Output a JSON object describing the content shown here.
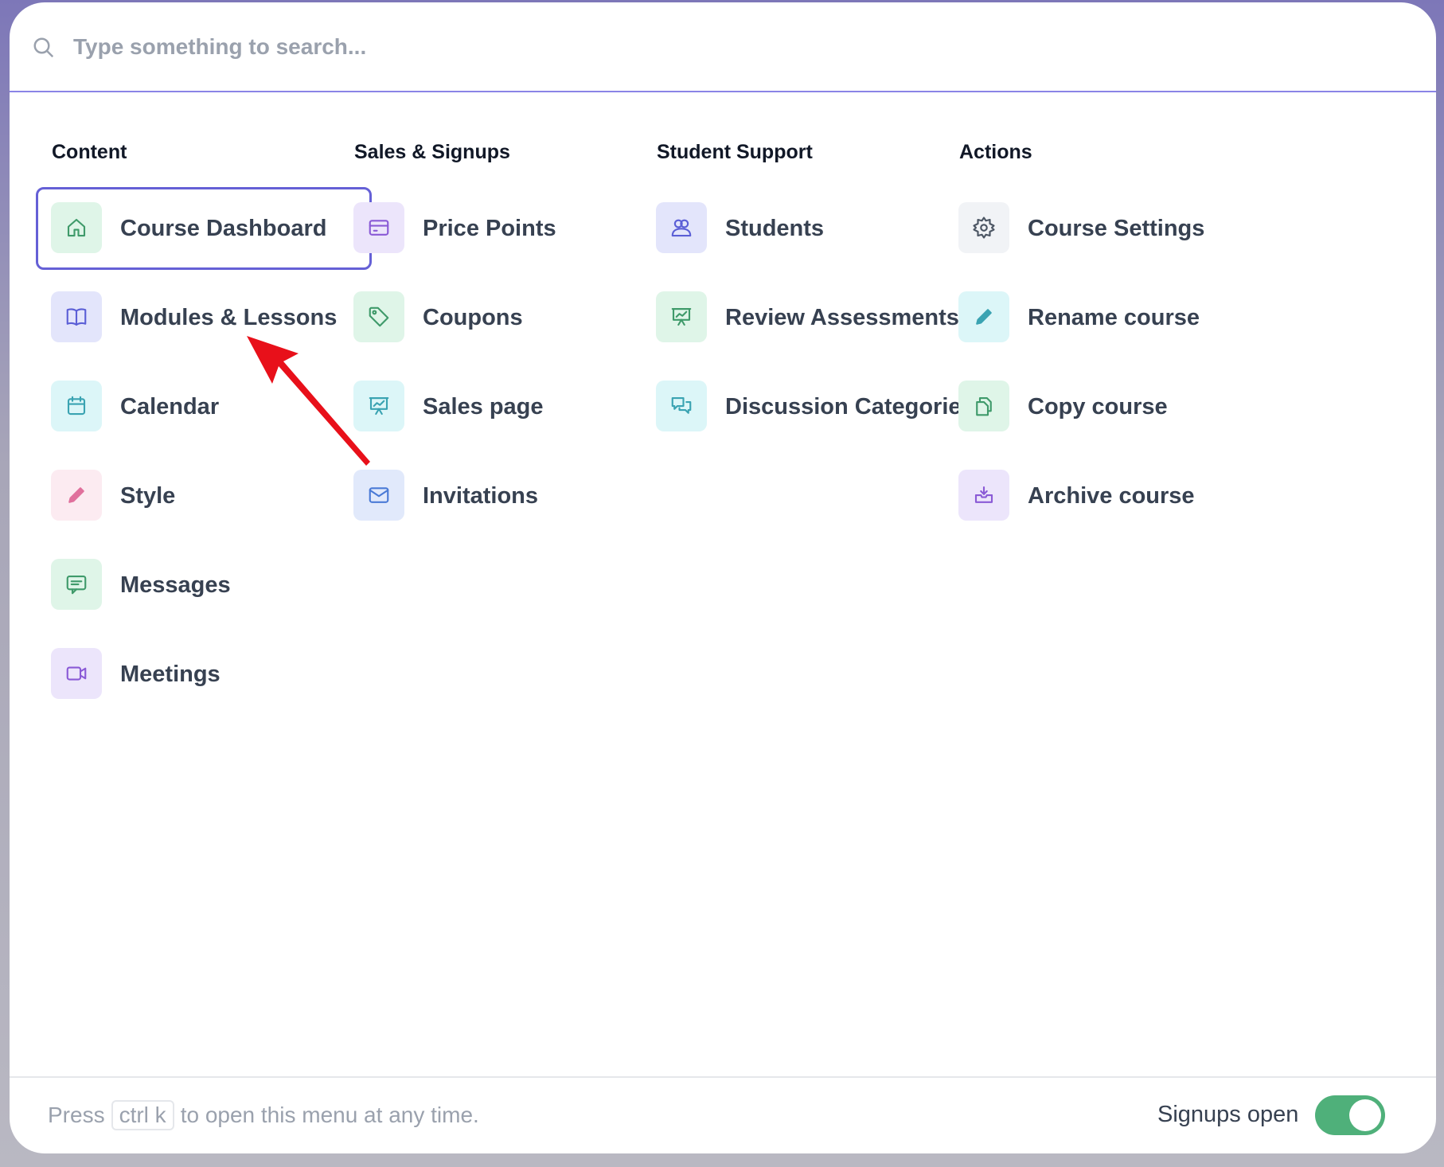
{
  "search": {
    "placeholder": "Type something to search..."
  },
  "columns": [
    {
      "title": "Content",
      "items": [
        {
          "label": "Course Dashboard",
          "icon": "home-icon",
          "bg": "#dff5e8",
          "fg": "#3f9a6a",
          "selected": true
        },
        {
          "label": "Modules & Lessons",
          "icon": "book-icon",
          "bg": "#e3e5fb",
          "fg": "#5b5fd6"
        },
        {
          "label": "Calendar",
          "icon": "calendar-icon",
          "bg": "#dcf6f8",
          "fg": "#3aa3b2"
        },
        {
          "label": "Style",
          "icon": "pencil-icon",
          "bg": "#fcebf1",
          "fg": "#e0709c"
        },
        {
          "label": "Messages",
          "icon": "message-icon",
          "bg": "#dff5e8",
          "fg": "#3f9a6a"
        },
        {
          "label": "Meetings",
          "icon": "video-icon",
          "bg": "#ece5fb",
          "fg": "#8a5ad6"
        }
      ]
    },
    {
      "title": "Sales & Signups",
      "items": [
        {
          "label": "Price Points",
          "icon": "credit-card-icon",
          "bg": "#ece5fb",
          "fg": "#8a5ad6"
        },
        {
          "label": "Coupons",
          "icon": "tag-icon",
          "bg": "#dff5e8",
          "fg": "#3f9a6a"
        },
        {
          "label": "Sales page",
          "icon": "presentation-chart-icon",
          "bg": "#dcf6f8",
          "fg": "#3aa3b2"
        },
        {
          "label": "Invitations",
          "icon": "mail-icon",
          "bg": "#e1e9fb",
          "fg": "#4a7ad6"
        }
      ]
    },
    {
      "title": "Student Support",
      "items": [
        {
          "label": "Students",
          "icon": "users-icon",
          "bg": "#e3e5fb",
          "fg": "#5b5fd6"
        },
        {
          "label": "Review Assessments",
          "icon": "presentation-chart-icon",
          "bg": "#dff5e8",
          "fg": "#3f9a6a"
        },
        {
          "label": "Discussion Categories",
          "icon": "chat-bubbles-icon",
          "bg": "#dcf6f8",
          "fg": "#3aa3b2"
        }
      ]
    },
    {
      "title": "Actions",
      "items": [
        {
          "label": "Course Settings",
          "icon": "gear-icon",
          "bg": "#f1f3f6",
          "fg": "#4b5563"
        },
        {
          "label": "Rename course",
          "icon": "pencil-icon",
          "bg": "#dcf6f8",
          "fg": "#3aa3b2"
        },
        {
          "label": "Copy course",
          "icon": "copy-icon",
          "bg": "#dff5e8",
          "fg": "#3f9a6a"
        },
        {
          "label": "Archive course",
          "icon": "archive-icon",
          "bg": "#ece5fb",
          "fg": "#8a5ad6"
        }
      ]
    }
  ],
  "footer": {
    "hint_prefix": "Press",
    "shortcut": "ctrl k",
    "hint_suffix": "to open this menu at any time.",
    "toggle_label": "Signups open",
    "toggle_on": true
  },
  "accent": "#6560d6",
  "annotation_color": "#e8101a"
}
